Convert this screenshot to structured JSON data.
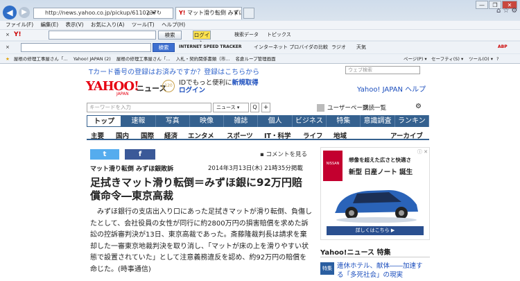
{
  "browser": {
    "url": "http://news.yahoo.co.jp/pickup/6110237",
    "addr_controls": "ρ ▾ ↻",
    "tab_title": "マット滑り転倒 みずほ銀...",
    "tab_close": "×",
    "window_buttons": [
      "—",
      "❐",
      "✕"
    ],
    "rhs_icons": "⌂☆⚙",
    "menu": [
      "ファイル(F)",
      "編集(E)",
      "表示(V)",
      "お気に入り(A)",
      "ツール(T)",
      "ヘルプ(H)"
    ],
    "toolbar1": {
      "close": "×",
      "yahoo": "Y!",
      "search_btn": "検索",
      "login_btn": "ログイン",
      "items": [
        "検索データ",
        "トピックス"
      ]
    },
    "toolbar2": {
      "close": "×",
      "search_btn": "検索",
      "items": [
        "INTERNET SPEED TRACKER",
        "インターネット プロバイダの比較",
        "ラジオ",
        "天気"
      ],
      "abp": "ABP"
    },
    "favorites": [
      "屋根の修理工事屋さん「...",
      "Yahoo! JAPAN (2)",
      "屋根の修理工事屋さん「...",
      "入札・契約関係書類（市...",
      "名倉ループ管理画面"
    ],
    "command_bar": [
      "ページ(P) ▾",
      "セーフティ(S) ▾",
      "ツール(O) ▾",
      "?"
    ]
  },
  "yahoo": {
    "tpoint": "Tカード番号の登録はお済みですか？登録はこちらから",
    "web_search_placeholder": "ウェブ検索",
    "logo": "YAHOO!",
    "logo_jp": "JAPAN",
    "news": "ニュース",
    "badge": "120",
    "id_promo_1": "IDでもっと便利に",
    "id_promo_link": "新規取得",
    "id_promo_2": "ログイン",
    "help": "Yahoo! JAPAN ヘルプ",
    "kw_placeholder": "キーワードを入力",
    "kw_select": "ニュース ▾",
    "kw_go": "Q",
    "kw_plus": "+",
    "userpage": "ユーザーページ",
    "subscribe": "購読一覧",
    "gear": "⚙",
    "categories": [
      "トップ",
      "速報",
      "写真",
      "映像",
      "雑誌",
      "個人",
      "ビジネス",
      "特集",
      "意識調査",
      "ランキング"
    ],
    "subnav": [
      "主要",
      "国内",
      "国際",
      "経済",
      "エンタメ",
      "スポーツ",
      "IT・科学",
      "ライフ",
      "地域",
      "アーカイブ"
    ]
  },
  "article": {
    "twitter": "t",
    "facebook": "f",
    "comment": "コメントを見る",
    "source": "マット滑り転倒 みずほ銀敗訴",
    "date": "2014年3月13日(木) 21時35分掲載",
    "headline": "足拭きマット滑り転倒＝みずほ銀に92万円賠償命令―東京高裁",
    "body": "みずほ銀行の支店出入り口にあった足拭きマットが滑り転倒、負傷したとして、会社役員の女性が同行に約2800万円の損害賠償を求めた訴訟の控訴審判決が13日、東京高裁であった。斎藤隆裁判長は請求を棄却した一審東京地裁判決を取り消し、「マットが床の上を滑りやすい状態で設置されていた」として注意義務違反を認め、約92万円の賠償を命じた。(時事通信)"
  },
  "ad": {
    "brand": "NISSAN",
    "close": "ⓘ ✕",
    "copy1": "想像を超えた広さと快適さ",
    "copy2": "新型 日産ノート 誕生",
    "cta": "詳しくはこちら ▶"
  },
  "special": {
    "heading": "Yahoo!ニュース 特集",
    "tag": "特集",
    "link": "連休ホテル、献体――加速する「多死社会」の現実"
  }
}
